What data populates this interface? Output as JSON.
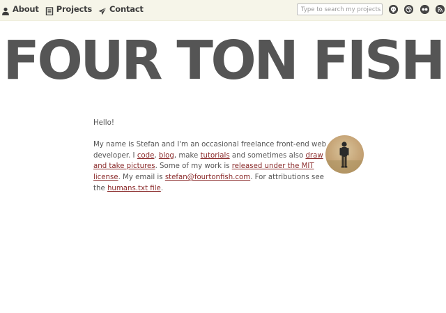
{
  "nav": {
    "items": [
      {
        "label": "About",
        "icon": "person-icon"
      },
      {
        "label": "Projects",
        "icon": "document-icon"
      },
      {
        "label": "Contact",
        "icon": "paper-plane-icon"
      }
    ]
  },
  "search": {
    "placeholder": "Type to search my projects",
    "value": ""
  },
  "social": {
    "icons": [
      "github-icon",
      "dribbble-icon",
      "flickr-icon",
      "rss-icon"
    ]
  },
  "site_title": "FOUR TON FISH",
  "intro": {
    "hello": "Hello!",
    "t1": "My name is Stefan and I'm an occasional freelance front-end web developer. I ",
    "link_code": "code",
    "t2": ", ",
    "link_blog": "blog",
    "t3": ", make ",
    "link_tutorials": "tutorials",
    "t4": " and sometimes also ",
    "link_draw": "draw and take pictures",
    "t5": ". Some of my work is ",
    "link_mit": "released under the MIT license",
    "t6": ". My email is ",
    "link_email": "stefan@fourtonfish.com",
    "t7": ". For attributions see the ",
    "link_humans": "humans.txt file",
    "t8": "."
  },
  "colors": {
    "topbar_bg": "#f6f5e9",
    "text": "#555555",
    "link": "#8a2a2a"
  }
}
